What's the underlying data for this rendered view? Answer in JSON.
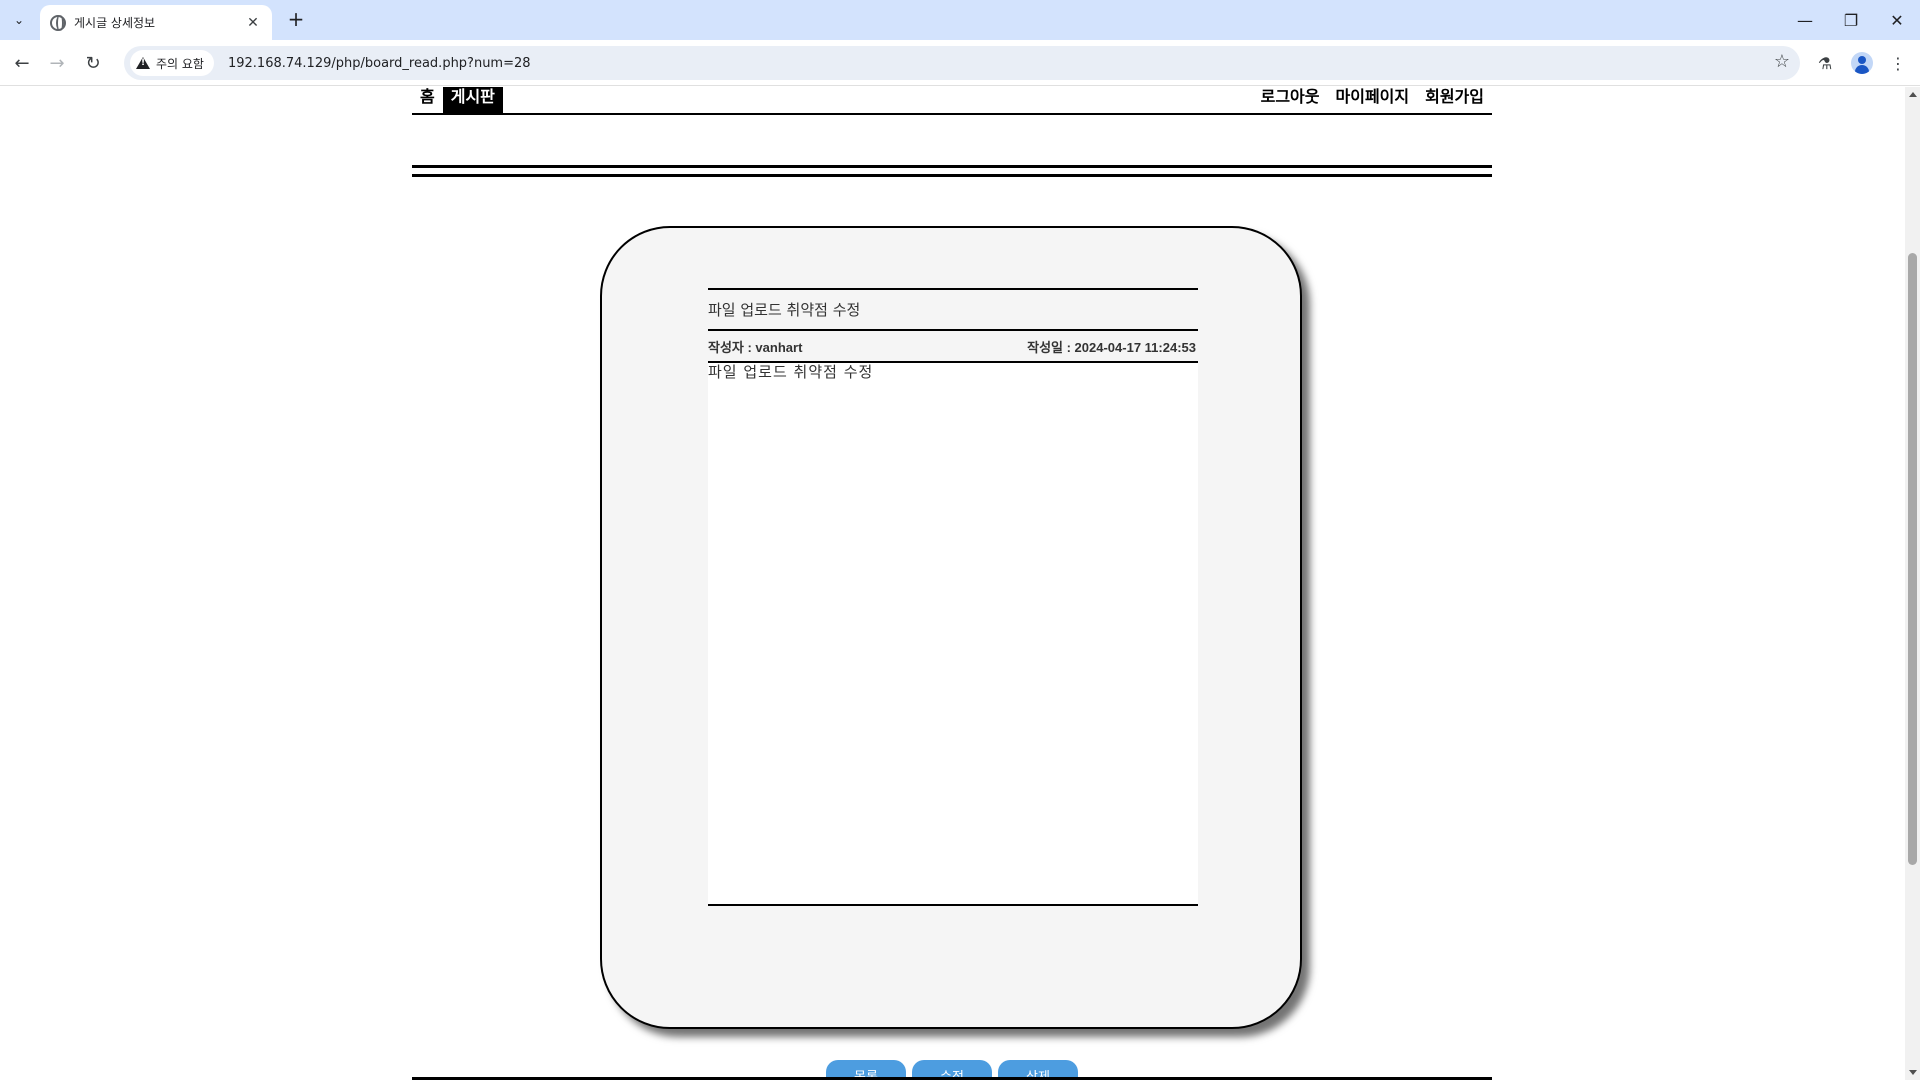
{
  "browser": {
    "tab_title": "게시글 상세정보",
    "security_label": "주의 요함",
    "url": "192.168.74.129/php/board_read.php?num=28"
  },
  "nav": {
    "left": [
      "홈",
      "게시판"
    ],
    "active": "게시판",
    "right": [
      "로그아웃",
      "마이페이지",
      "회원가입"
    ]
  },
  "post": {
    "title": "파일 업로드 취약점 수정",
    "author_label": "작성자 : vanhart",
    "date_label": "작성일 : 2024-04-17 11:24:53",
    "content": "파일 업로드 취약점 수정"
  },
  "buttons": {
    "list": "목록",
    "edit": "수정",
    "delete": "삭제"
  },
  "icons": {
    "tab_search": "chevron-down-icon",
    "favicon": "globe-icon",
    "close": "close-icon",
    "new_tab": "plus-icon",
    "warning": "warning-icon",
    "bookmark": "star-icon",
    "labs": "flask-icon",
    "profile": "person-icon",
    "menu": "kebab-menu-icon"
  },
  "colors": {
    "tabstrip": "#d3e3fd",
    "button": "#4d9de0",
    "card_bg": "#f5f5f5"
  }
}
